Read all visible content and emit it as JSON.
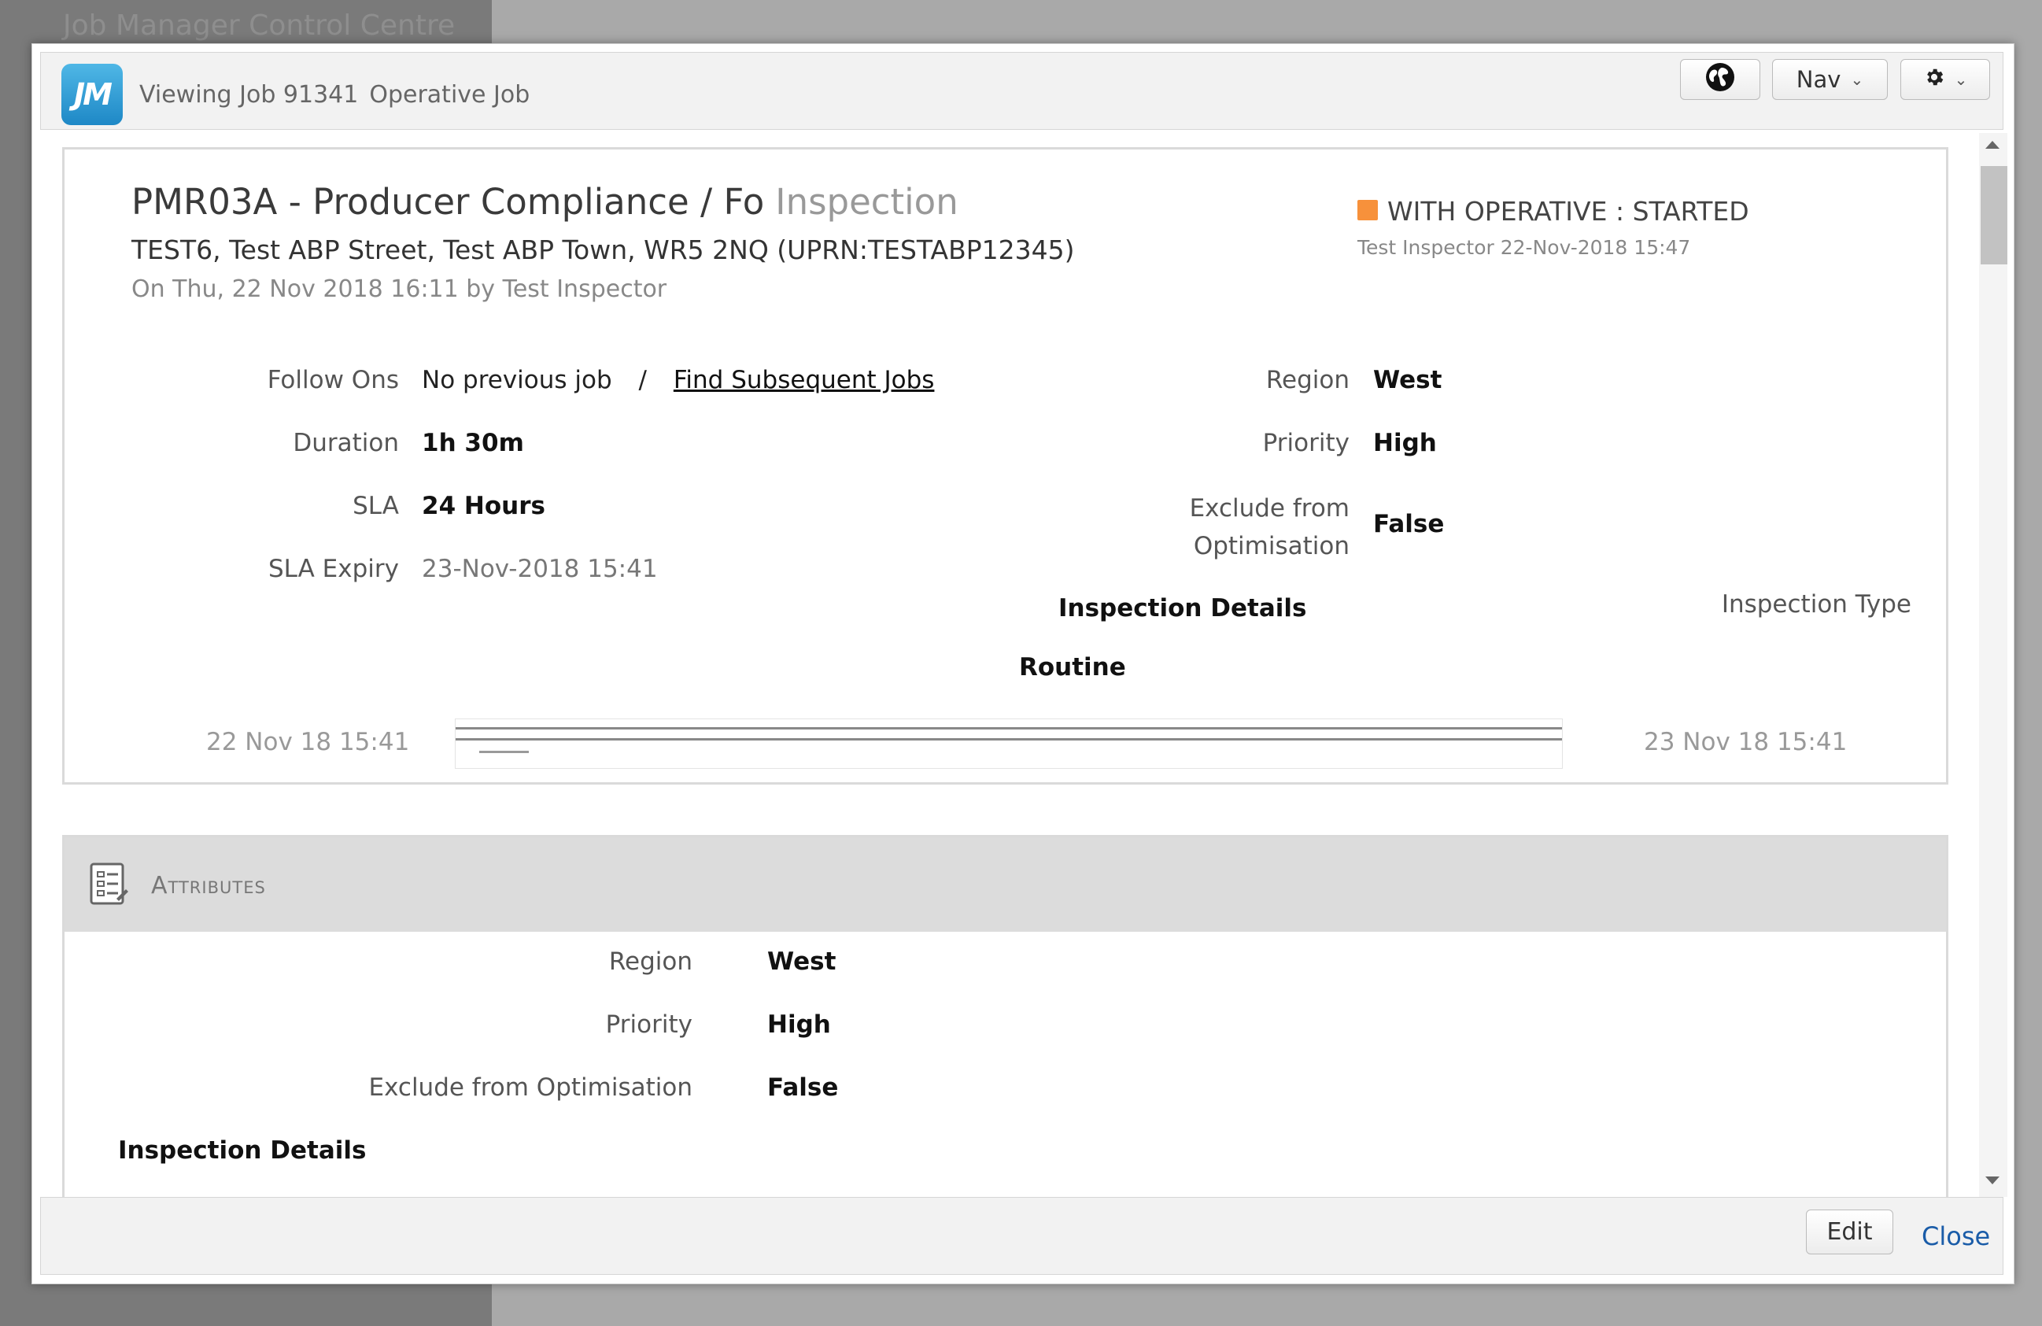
{
  "background": {
    "title": "Job Manager Control Centre"
  },
  "header": {
    "logo_text": "JM",
    "title": "Viewing Job 91341",
    "subtitle": "Operative Job",
    "nav_label": "Nav"
  },
  "job": {
    "title": "PMR03A - Producer Compliance / Fo",
    "type": "Inspection",
    "address": "TEST6, Test ABP Street, Test ABP Town, WR5 2NQ (UPRN:TESTABP12345)",
    "created": "On Thu, 22 Nov 2018 16:11 by Test Inspector",
    "status": "WITH OPERATIVE : STARTED",
    "status_by": "Test Inspector 22-Nov-2018 15:47",
    "status_color": "#f7913b"
  },
  "details": {
    "follow_ons_label": "Follow Ons",
    "follow_ons_value": "No previous job",
    "separator": "/",
    "find_subsequent": "Find Subsequent Jobs",
    "duration_label": "Duration",
    "duration_value": "1h 30m",
    "sla_label": "SLA",
    "sla_value": "24 Hours",
    "sla_expiry_label": "SLA Expiry",
    "sla_expiry_value": "23-Nov-2018 15:41",
    "region_label": "Region",
    "region_value": "West",
    "priority_label": "Priority",
    "priority_value": "High",
    "exclude_label_1": "Exclude from",
    "exclude_label_2": "Optimisation",
    "exclude_value": "False",
    "inspection_details": "Inspection Details",
    "inspection_type_label": "Inspection Type",
    "inspection_type_value": "Routine"
  },
  "timeline": {
    "start": "22 Nov 18 15:41",
    "end": "23 Nov 18 15:41",
    "progress": 0.045
  },
  "attributes": {
    "title": "Attributes",
    "region_label": "Region",
    "region_value": "West",
    "priority_label": "Priority",
    "priority_value": "High",
    "exclude_label": "Exclude from Optimisation",
    "exclude_value": "False",
    "inspection_details": "Inspection Details"
  },
  "footer": {
    "edit_label": "Edit",
    "close_label": "Close"
  }
}
